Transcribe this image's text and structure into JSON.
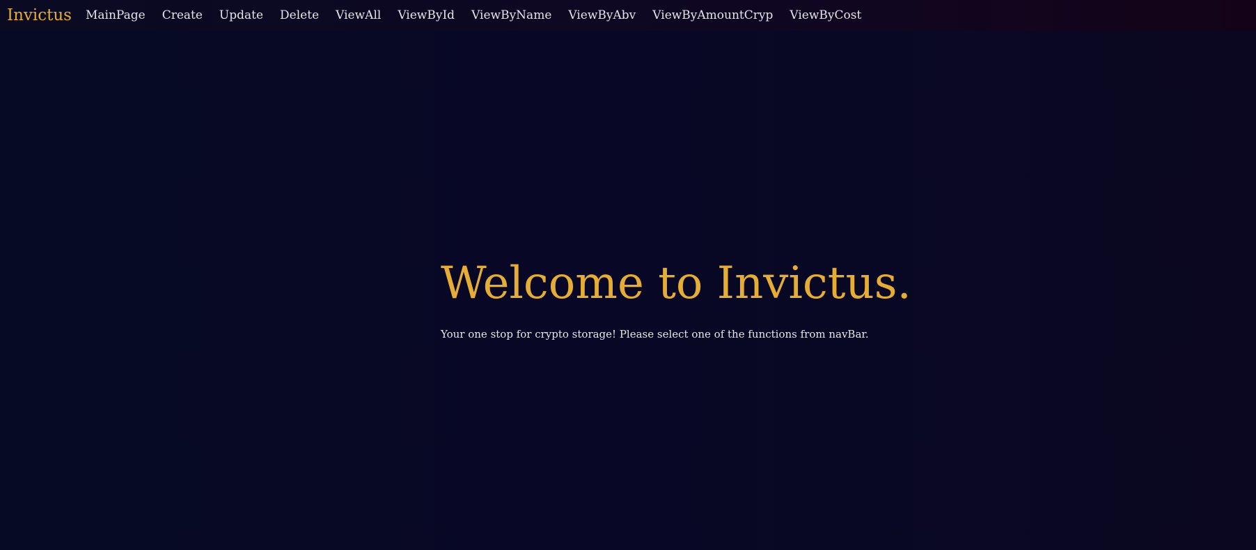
{
  "navbar": {
    "brand": "Invictus",
    "links": [
      {
        "label": "MainPage"
      },
      {
        "label": "Create"
      },
      {
        "label": "Update"
      },
      {
        "label": "Delete"
      },
      {
        "label": "ViewAll"
      },
      {
        "label": "ViewById"
      },
      {
        "label": "ViewByName"
      },
      {
        "label": "ViewByAbv"
      },
      {
        "label": "ViewByAmountCryp"
      },
      {
        "label": "ViewByCost"
      }
    ]
  },
  "hero": {
    "title": "Welcome to Invictus.",
    "subtitle": "Your one stop for crypto storage! Please select one of the functions from navBar."
  },
  "colors": {
    "accent": "#e6ad34",
    "background": "#070a24",
    "text": "#e6e6ec"
  }
}
